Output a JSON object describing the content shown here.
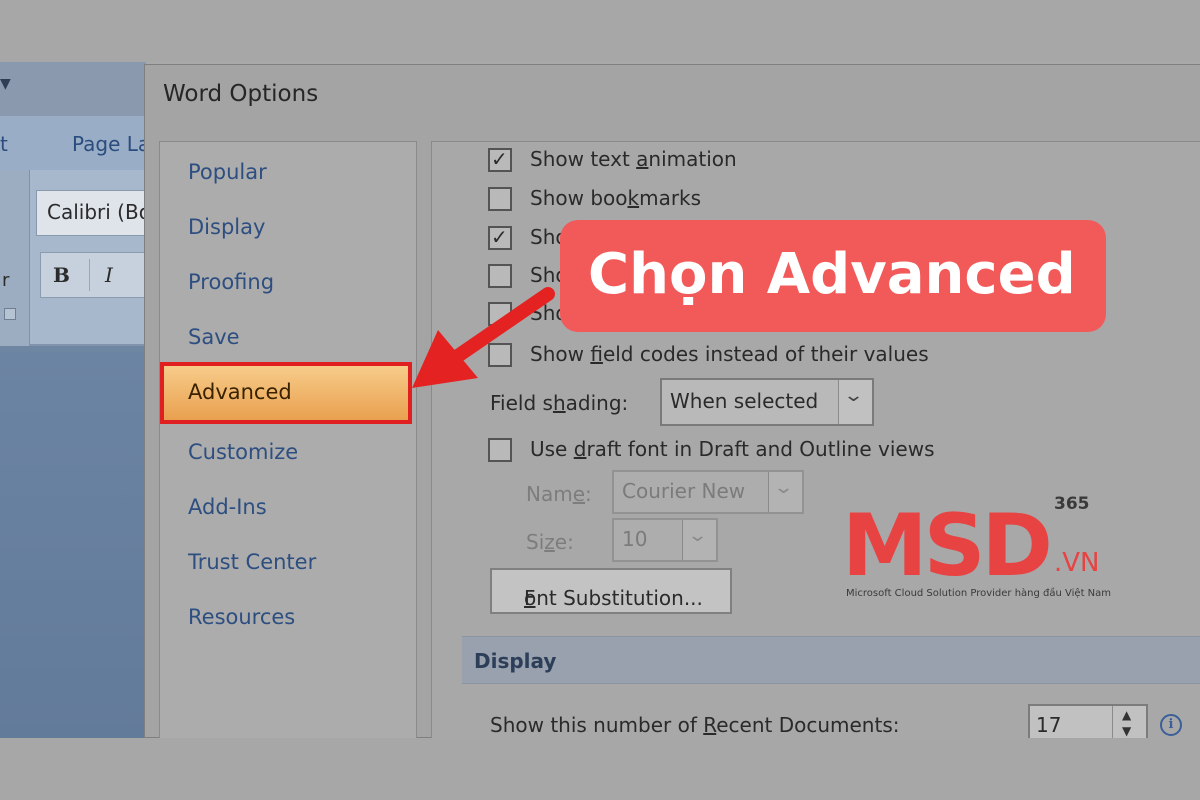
{
  "word": {
    "tab_partial": "t",
    "tab_page": "Page La",
    "font_value": "Calibri (Bo",
    "bold": "B",
    "italic": "I",
    "ribbon_letter": "r"
  },
  "dialog": {
    "title": "Word Options"
  },
  "nav": {
    "items": [
      {
        "label": "Popular"
      },
      {
        "label": "Display"
      },
      {
        "label": "Proofing"
      },
      {
        "label": "Save"
      },
      {
        "label": "Advanced"
      },
      {
        "label": "Customize"
      },
      {
        "label": "Add-Ins"
      },
      {
        "label": "Trust Center"
      },
      {
        "label": "Resources"
      }
    ],
    "selected": "Advanced"
  },
  "options": {
    "text_animation": {
      "label_a": "Show text ",
      "label_u": "a",
      "label_b": "nimation",
      "checked": true
    },
    "bookmarks": {
      "label_a": "Show boo",
      "label_u": "k",
      "label_b": "marks",
      "checked": false
    },
    "partial_1": {
      "label": "Sho",
      "checked": true
    },
    "partial_2": {
      "label": "Sho",
      "checked": false
    },
    "partial_3": {
      "label": "Sho",
      "checked": false
    },
    "field_codes": {
      "label_a": "Show ",
      "label_u": "f",
      "label_b": "ield codes instead of their values",
      "checked": false
    },
    "field_shading": {
      "label_a": "Field s",
      "label_u": "h",
      "label_b": "ading:",
      "value": "When selected"
    },
    "draft_font": {
      "label_a": "Use ",
      "label_u": "d",
      "label_b": "raft font in Draft and Outline views",
      "checked": false
    },
    "name": {
      "label_a": "Nam",
      "label_u": "e",
      "label_b": ":",
      "value": "Courier New"
    },
    "size": {
      "label_a": "Si",
      "label_u": "z",
      "label_b": "e:",
      "value": "10"
    },
    "font_substitution": {
      "label_u": "F",
      "label_b": "ont Substitution..."
    }
  },
  "display_section": {
    "header": "Display",
    "recent_docs": {
      "label_a": "Show this number of ",
      "label_u": "R",
      "label_b": "ecent Documents:",
      "value": "17"
    }
  },
  "annotation": {
    "callout_text": "Chọn Advanced",
    "color": "#f25a5a",
    "arrow_color": "#e52222"
  },
  "logo": {
    "text_msd": "MSD",
    "text_365": "365",
    "text_vn": ".VN",
    "tagline": "Microsoft Cloud Solution Provider hàng đầu Việt Nam",
    "color": "#e84343"
  }
}
